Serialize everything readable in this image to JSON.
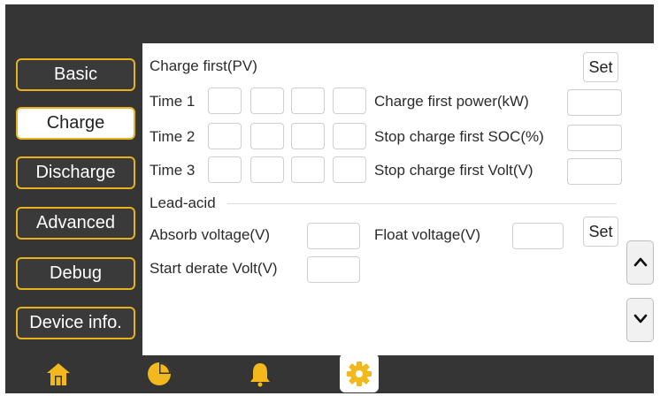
{
  "nav": {
    "items": [
      {
        "label": "Basic"
      },
      {
        "label": "Charge"
      },
      {
        "label": "Discharge"
      },
      {
        "label": "Advanced"
      },
      {
        "label": "Debug"
      },
      {
        "label": "Device info."
      }
    ],
    "active": "Charge"
  },
  "charge": {
    "section_title": "Charge first(PV)",
    "set_label": "Set",
    "time_labels": [
      "Time 1",
      "Time 2",
      "Time 3"
    ],
    "charge_first_power_label": "Charge first power(kW)",
    "stop_charge_soc_label": "Stop charge first SOC(%)",
    "stop_charge_volt_label": "Stop charge first Volt(V)"
  },
  "lead_acid": {
    "section_title": "Lead-acid",
    "absorb_voltage_label": "Absorb voltage(V)",
    "float_voltage_label": "Float voltage(V)",
    "start_derate_label": "Start derate Volt(V)",
    "set_label": "Set"
  },
  "bottom_bar": {
    "tabs": [
      "home-icon",
      "pie-chart-icon",
      "bell-icon",
      "gear-icon"
    ],
    "active": "gear-icon"
  },
  "colors": {
    "frame": "#353535",
    "accent": "#e7b21b",
    "panel": "#ffffff"
  }
}
